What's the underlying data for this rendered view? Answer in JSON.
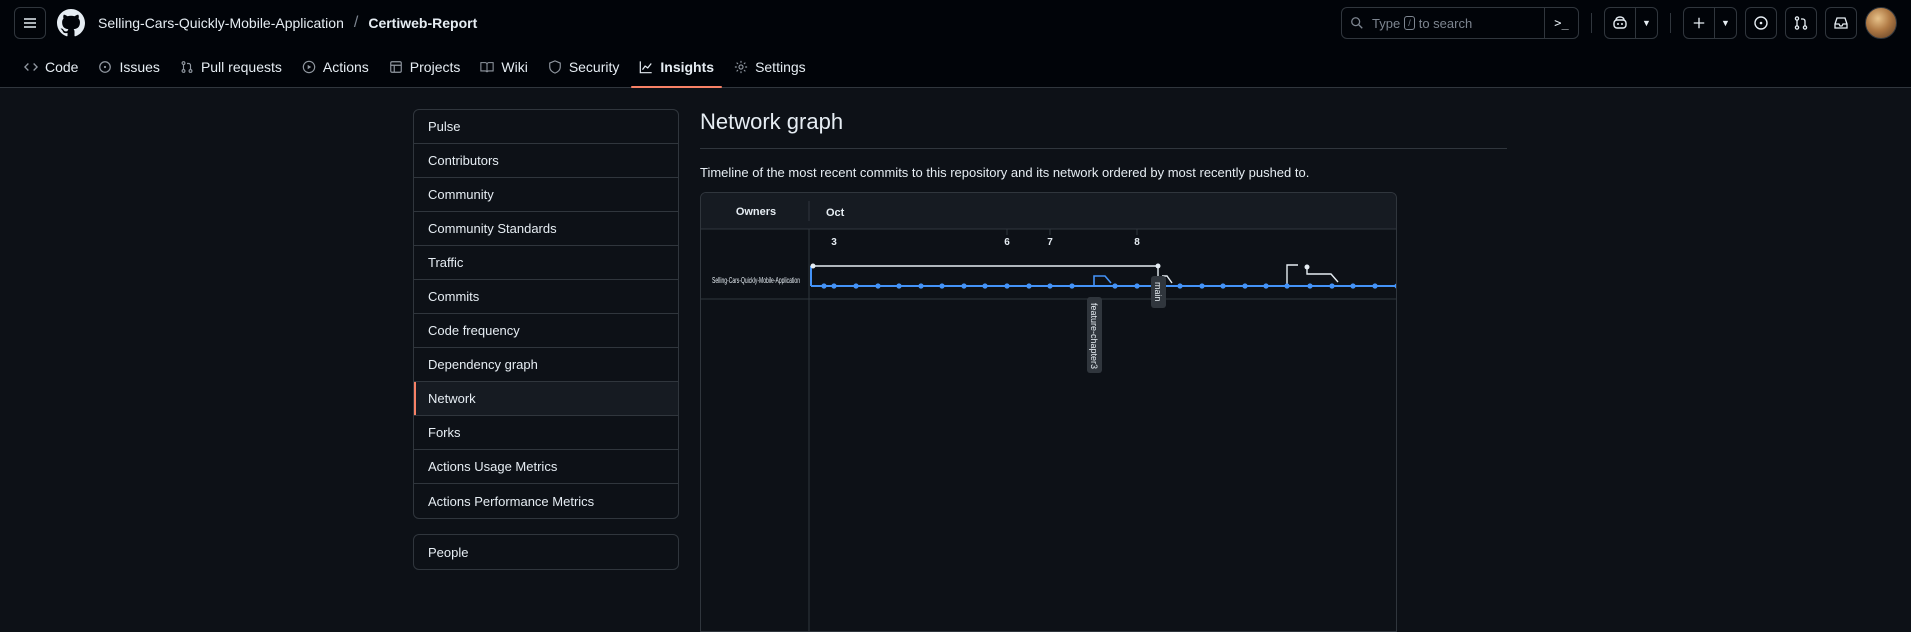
{
  "topbar": {
    "owner": "Selling-Cars-Quickly-Mobile-Application",
    "separator": "/",
    "repo": "Certiweb-Report",
    "search_prefix": "Type",
    "search_key": "/",
    "search_suffix": "to search",
    "command_glyph": ">_"
  },
  "tabs": [
    {
      "label": "Code",
      "icon": "code-icon"
    },
    {
      "label": "Issues",
      "icon": "issue-icon"
    },
    {
      "label": "Pull requests",
      "icon": "pull-request-icon"
    },
    {
      "label": "Actions",
      "icon": "play-icon"
    },
    {
      "label": "Projects",
      "icon": "table-icon"
    },
    {
      "label": "Wiki",
      "icon": "book-icon"
    },
    {
      "label": "Security",
      "icon": "shield-icon"
    },
    {
      "label": "Insights",
      "icon": "graph-icon",
      "active": true
    },
    {
      "label": "Settings",
      "icon": "gear-icon"
    }
  ],
  "sidebar": {
    "items": [
      "Pulse",
      "Contributors",
      "Community",
      "Community Standards",
      "Traffic",
      "Commits",
      "Code frequency",
      "Dependency graph",
      "Network",
      "Forks",
      "Actions Usage Metrics",
      "Actions Performance Metrics"
    ],
    "selected": "Network",
    "people": "People"
  },
  "main": {
    "title": "Network graph",
    "description": "Timeline of the most recent commits to this repository and its network ordered by most recently pushed to."
  },
  "graph": {
    "owners_label": "Owners",
    "month": "Oct",
    "days": [
      "3",
      "6",
      "7",
      "8"
    ],
    "owner_row": "Selling-Cars-Quickly-Mobile-Application",
    "branch_labels": [
      "feature-chapter3",
      "main"
    ]
  },
  "colors": {
    "accent": "#f78166",
    "main_line": "#4493f8",
    "bg": "#0d1117",
    "border": "#30363d"
  }
}
